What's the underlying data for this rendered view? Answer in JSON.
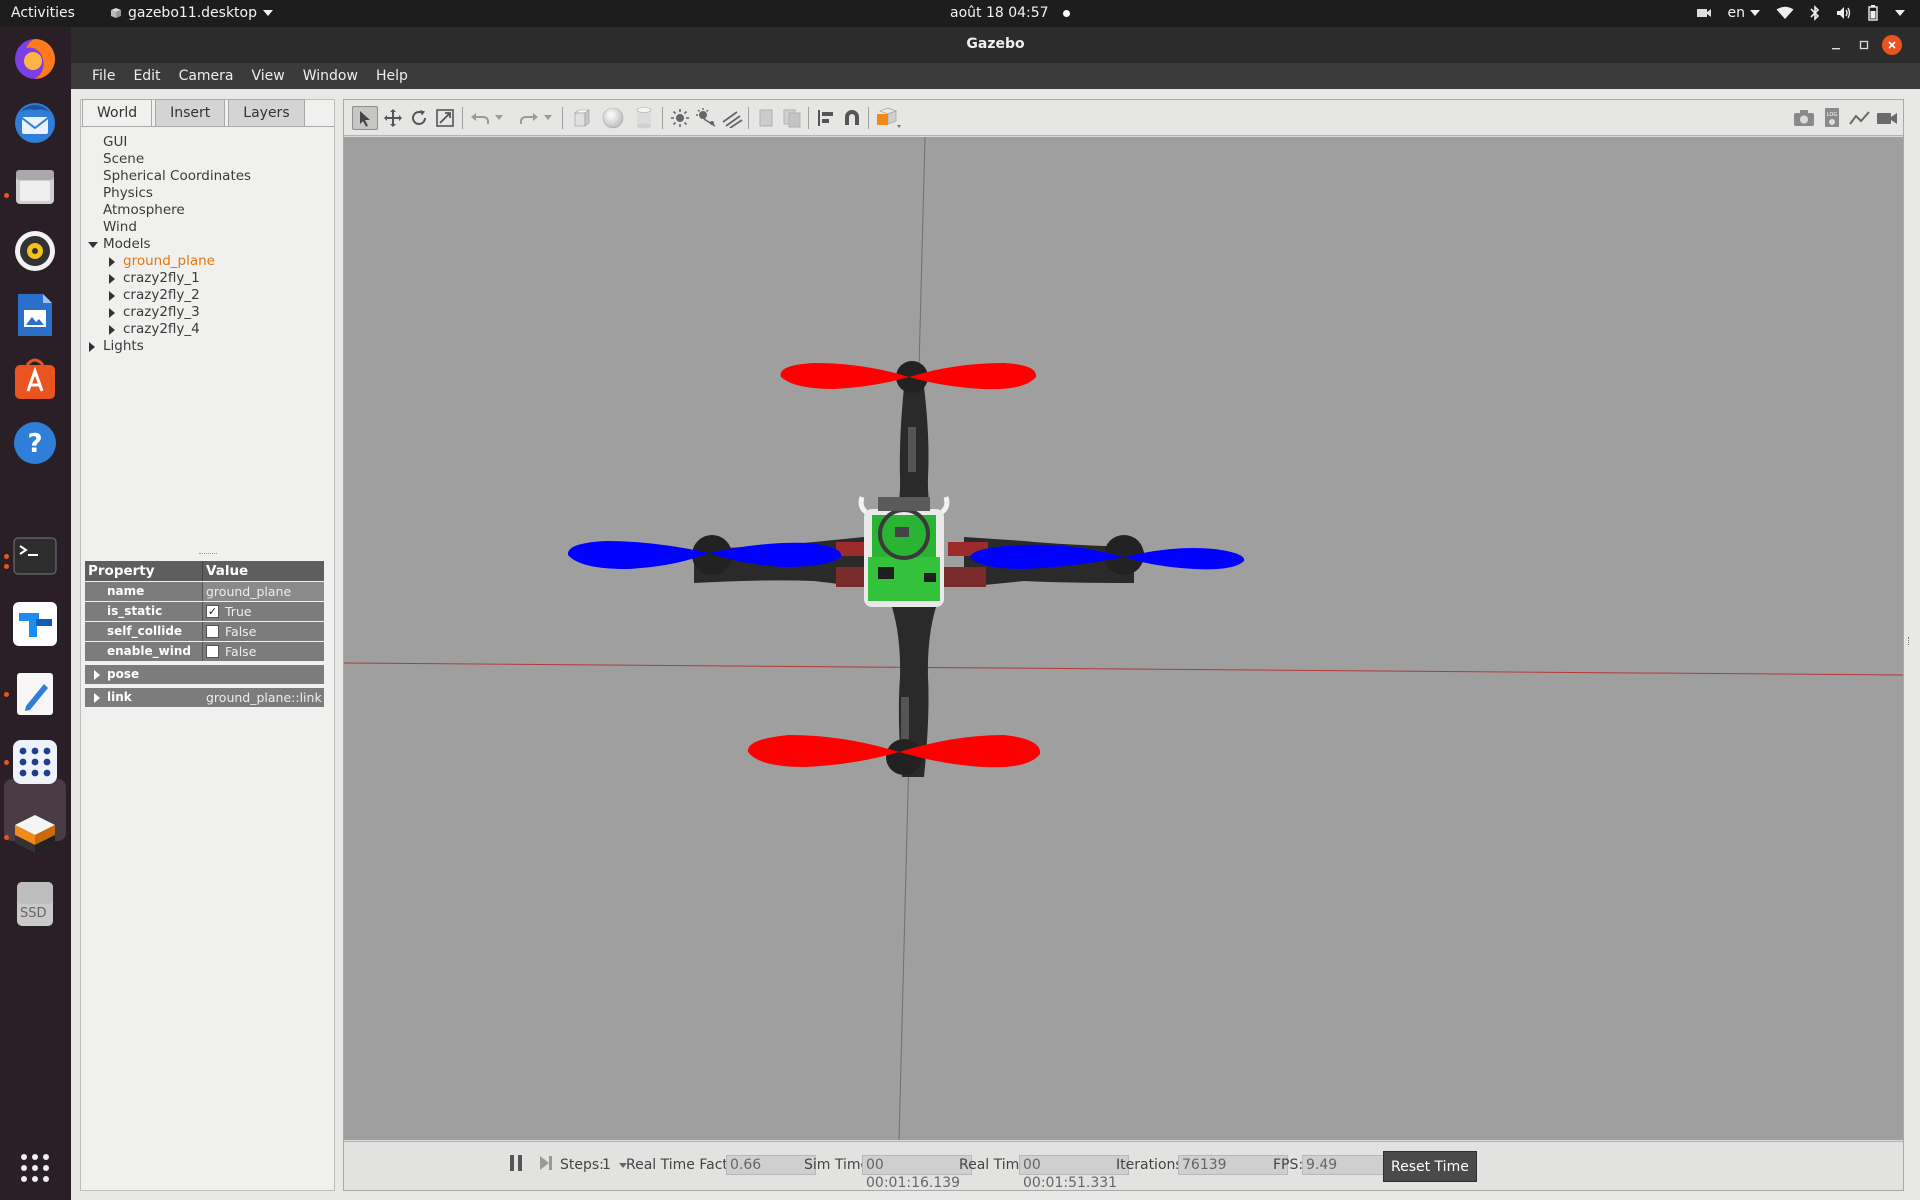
{
  "topbar": {
    "activities": "Activities",
    "app_menu": "gazebo11.desktop",
    "clock": "août 18  04:57",
    "lang": "en"
  },
  "dock": {
    "items": [
      "firefox-icon",
      "thunderbird-icon",
      "files-icon",
      "rhythmbox-icon",
      "writer-icon",
      "app-center-icon",
      "help-icon",
      "terminal-icon",
      "teamviewer-icon",
      "text-editor-icon",
      "grid-app-icon",
      "gazebo-icon",
      "ssd-drive-icon",
      "show-apps-icon"
    ],
    "ssd_label": "SSD"
  },
  "window": {
    "title": "Gazebo",
    "menu": [
      "File",
      "Edit",
      "Camera",
      "View",
      "Window",
      "Help"
    ]
  },
  "left": {
    "tabs": [
      "World",
      "Insert",
      "Layers"
    ],
    "tree": {
      "items": [
        "GUI",
        "Scene",
        "Spherical Coordinates",
        "Physics",
        "Atmosphere",
        "Wind"
      ],
      "models_label": "Models",
      "models": [
        "ground_plane",
        "crazy2fly_1",
        "crazy2fly_2",
        "crazy2fly_3",
        "crazy2fly_4"
      ],
      "lights_label": "Lights"
    },
    "properties": {
      "header": [
        "Property",
        "Value"
      ],
      "name": {
        "label": "name",
        "value": "ground_plane"
      },
      "is_static": {
        "label": "is_static",
        "value": "True",
        "checked": true
      },
      "self_collide": {
        "label": "self_collide",
        "value": "False",
        "checked": false
      },
      "enable_wind": {
        "label": "enable_wind",
        "value": "False",
        "checked": false
      },
      "pose": {
        "label": "pose"
      },
      "link": {
        "label": "link",
        "value": "ground_plane::link"
      }
    }
  },
  "bottom": {
    "steps_label": "Steps:",
    "steps_value": "1",
    "rtf_label": "Real Time Factor:",
    "rtf_value": "0.66",
    "sim_time_label": "Sim Time:",
    "sim_time_value": "00 00:01:16.139",
    "real_time_label": "Real Time:",
    "real_time_value": "00 00:01:51.331",
    "iterations_label": "Iterations:",
    "iterations_value": "76139",
    "fps_label": "FPS:",
    "fps_value": "9.49",
    "reset_label": "Reset Time"
  },
  "colors": {
    "accent": "#e95420",
    "selected_tree": "#e7760f",
    "propeller_front_back": "#ff0000",
    "propeller_left_right": "#0000ff",
    "pcb": "#2bb334"
  }
}
